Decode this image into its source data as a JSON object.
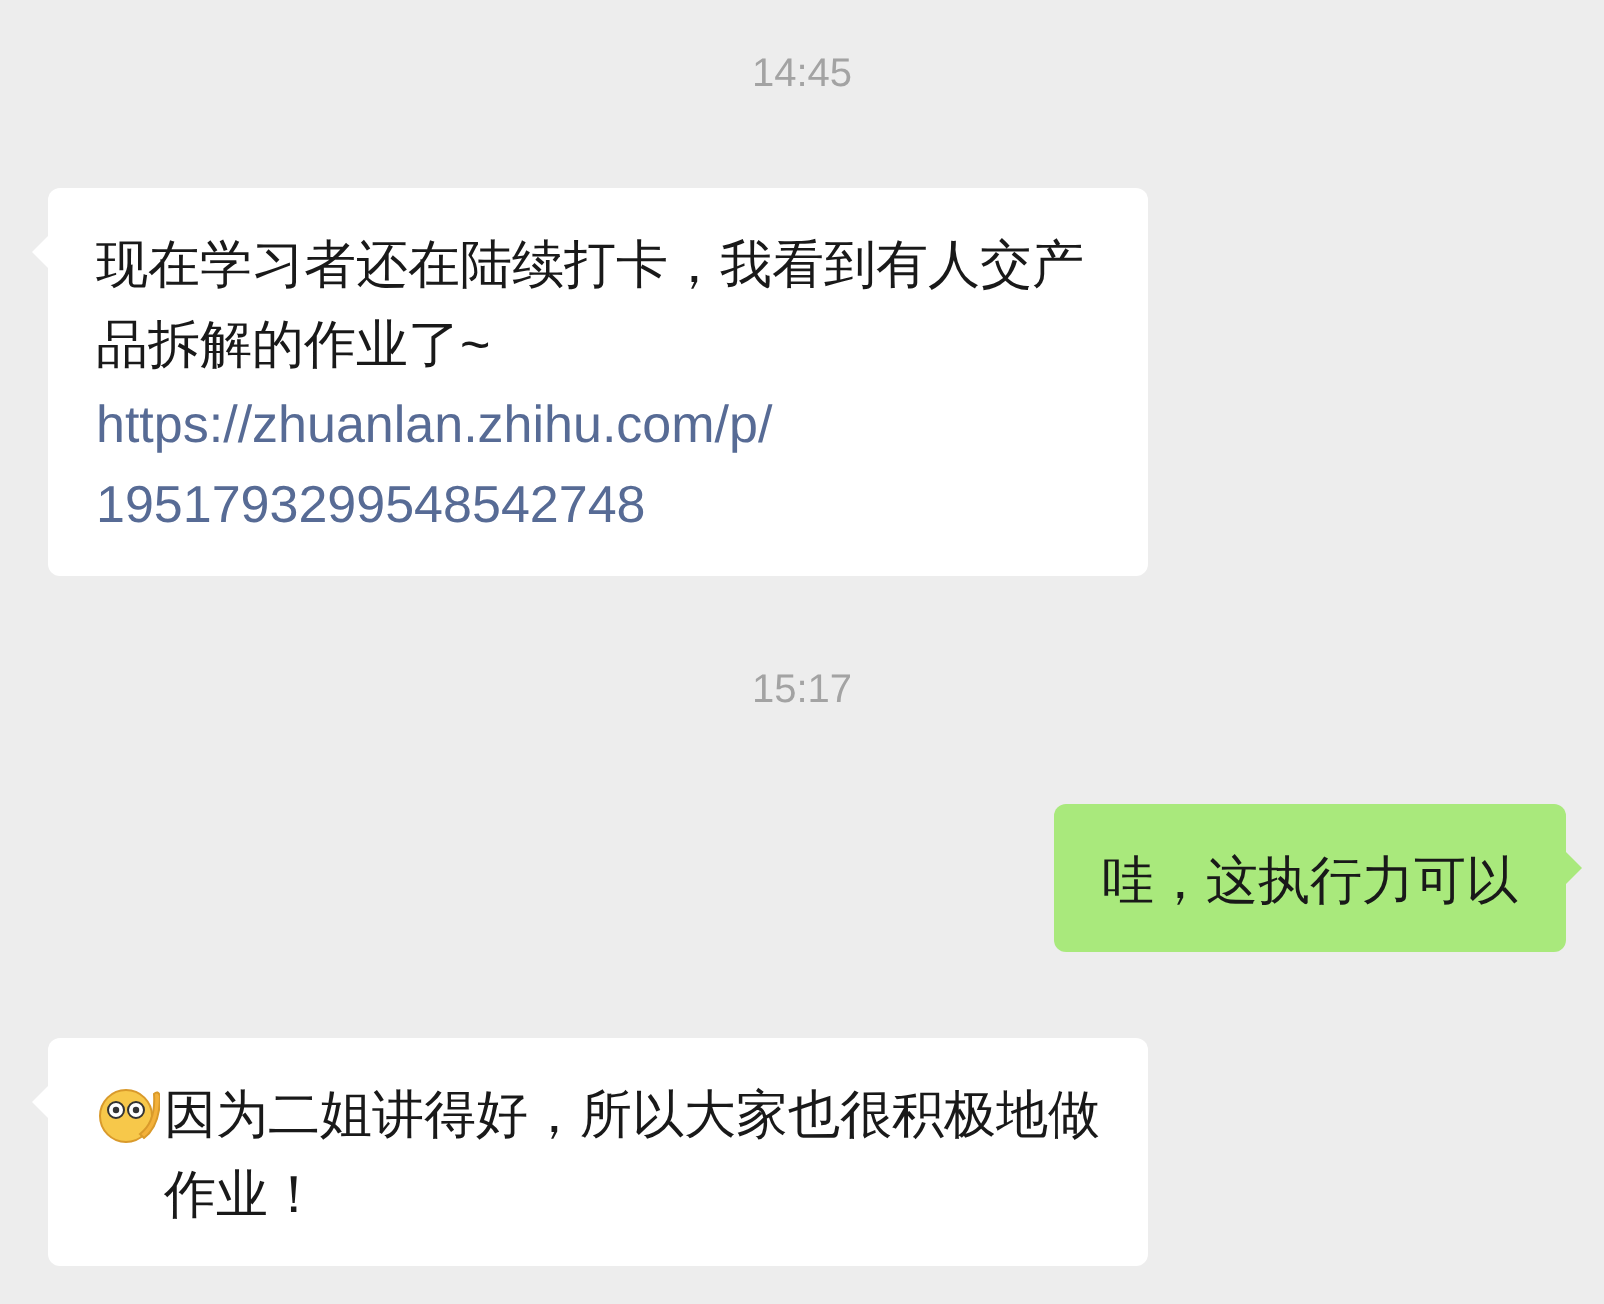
{
  "messages": [
    {
      "kind": "time",
      "text": "14:45"
    },
    {
      "kind": "incoming",
      "parts": [
        {
          "kind": "text",
          "text": "现在学习者还在陆续打卡，我看到有人交产品拆解的作业了~"
        },
        {
          "kind": "link",
          "text": "https://zhuanlan.zhihu.com/p/1951793299548542748"
        }
      ]
    },
    {
      "kind": "time",
      "text": "15:17"
    },
    {
      "kind": "outgoing",
      "parts": [
        {
          "kind": "text",
          "text": "哇，这执行力可以"
        }
      ]
    },
    {
      "kind": "incoming",
      "parts": [
        {
          "kind": "emoji"
        },
        {
          "kind": "text",
          "text": "因为二姐讲得好，所以大家也很积极地做作业！"
        }
      ]
    }
  ]
}
